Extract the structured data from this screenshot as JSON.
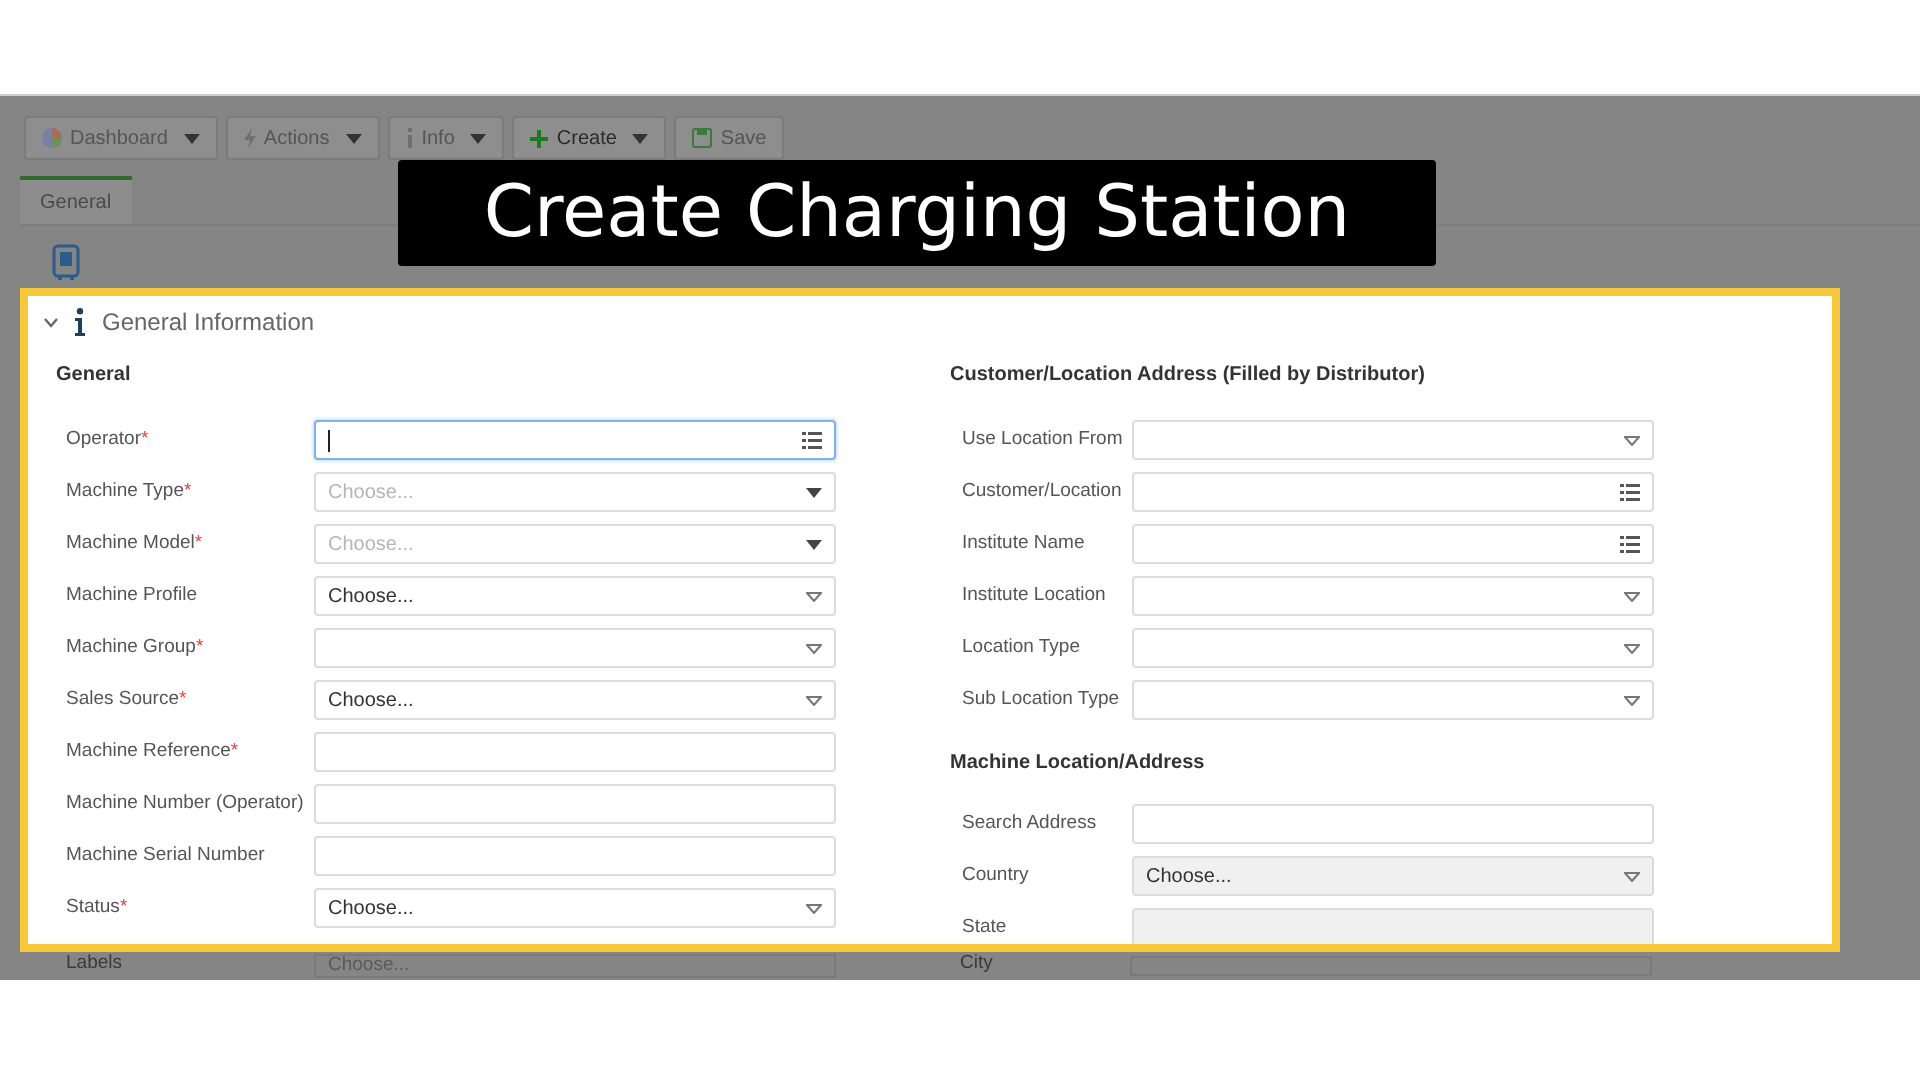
{
  "banner": {
    "title": "Create Charging Station"
  },
  "toolbar": [
    {
      "label": "Dashboard",
      "kind": "pie",
      "caret": true
    },
    {
      "label": "Actions",
      "kind": "bolt",
      "caret": true
    },
    {
      "label": "Info",
      "kind": "info",
      "caret": true
    },
    {
      "label": "Create",
      "kind": "plus",
      "caret": true
    },
    {
      "label": "Save",
      "kind": "save",
      "caret": false
    }
  ],
  "tabs": [
    {
      "label": "General",
      "selected": true
    }
  ],
  "section": {
    "title": "General Information",
    "expanded": true
  },
  "left": {
    "heading": "General",
    "fields": [
      {
        "label": "Operator",
        "required_mark": "*",
        "kind": "lookup",
        "focused": true,
        "disabled": false
      },
      {
        "label": "Machine Type",
        "required_mark": "*",
        "kind": "dropdown",
        "placeholder": "Choose...",
        "focused": false,
        "disabled": false
      },
      {
        "label": "Machine Model",
        "required_mark": "*",
        "kind": "dropdown",
        "placeholder": "Choose...",
        "focused": false,
        "disabled": false
      },
      {
        "label": "Machine Profile",
        "kind": "combo",
        "value": "Choose...",
        "focused": false,
        "disabled": false
      },
      {
        "label": "Machine Group",
        "required_mark": "*",
        "kind": "combo",
        "focused": false,
        "disabled": false
      },
      {
        "label": "Sales Source",
        "required_mark": "*",
        "kind": "combo",
        "value": "Choose...",
        "focused": false,
        "disabled": false
      },
      {
        "label": "Machine Reference",
        "required_mark": "*",
        "kind": "text",
        "focused": false,
        "disabled": false
      },
      {
        "label": "Machine Number (Operator)",
        "kind": "text",
        "focused": false,
        "disabled": false
      },
      {
        "label": "Machine Serial Number",
        "kind": "text",
        "focused": false,
        "disabled": false
      },
      {
        "label": "Status",
        "required_mark": "*",
        "kind": "combo",
        "value": "Choose...",
        "focused": false,
        "disabled": false
      }
    ]
  },
  "right": {
    "heading": "Customer/Location Address (Filled by Distributor)",
    "fields": [
      {
        "label": "Use Location From",
        "kind": "combo",
        "focused": false,
        "disabled": false
      },
      {
        "label": "Customer/Location",
        "kind": "lookup",
        "focused": false,
        "disabled": false
      },
      {
        "label": "Institute Name",
        "kind": "lookup",
        "focused": false,
        "disabled": false
      },
      {
        "label": "Institute Location",
        "kind": "combo",
        "focused": false,
        "disabled": false
      },
      {
        "label": "Location Type",
        "kind": "combo",
        "focused": false,
        "disabled": false
      },
      {
        "label": "Sub Location Type",
        "kind": "combo",
        "focused": false,
        "disabled": false
      }
    ],
    "heading2": "Machine Location/Address",
    "fields2": [
      {
        "label": "Search Address",
        "kind": "text",
        "focused": false,
        "disabled": false
      },
      {
        "label": "Country",
        "kind": "combo",
        "value": "Choose...",
        "focused": false,
        "disabled": true
      },
      {
        "label": "State",
        "kind": "text",
        "focused": false,
        "disabled": true
      }
    ]
  },
  "below": [
    {
      "label": "Labels",
      "placeholder": "Choose..."
    },
    {
      "label": "City"
    }
  ]
}
